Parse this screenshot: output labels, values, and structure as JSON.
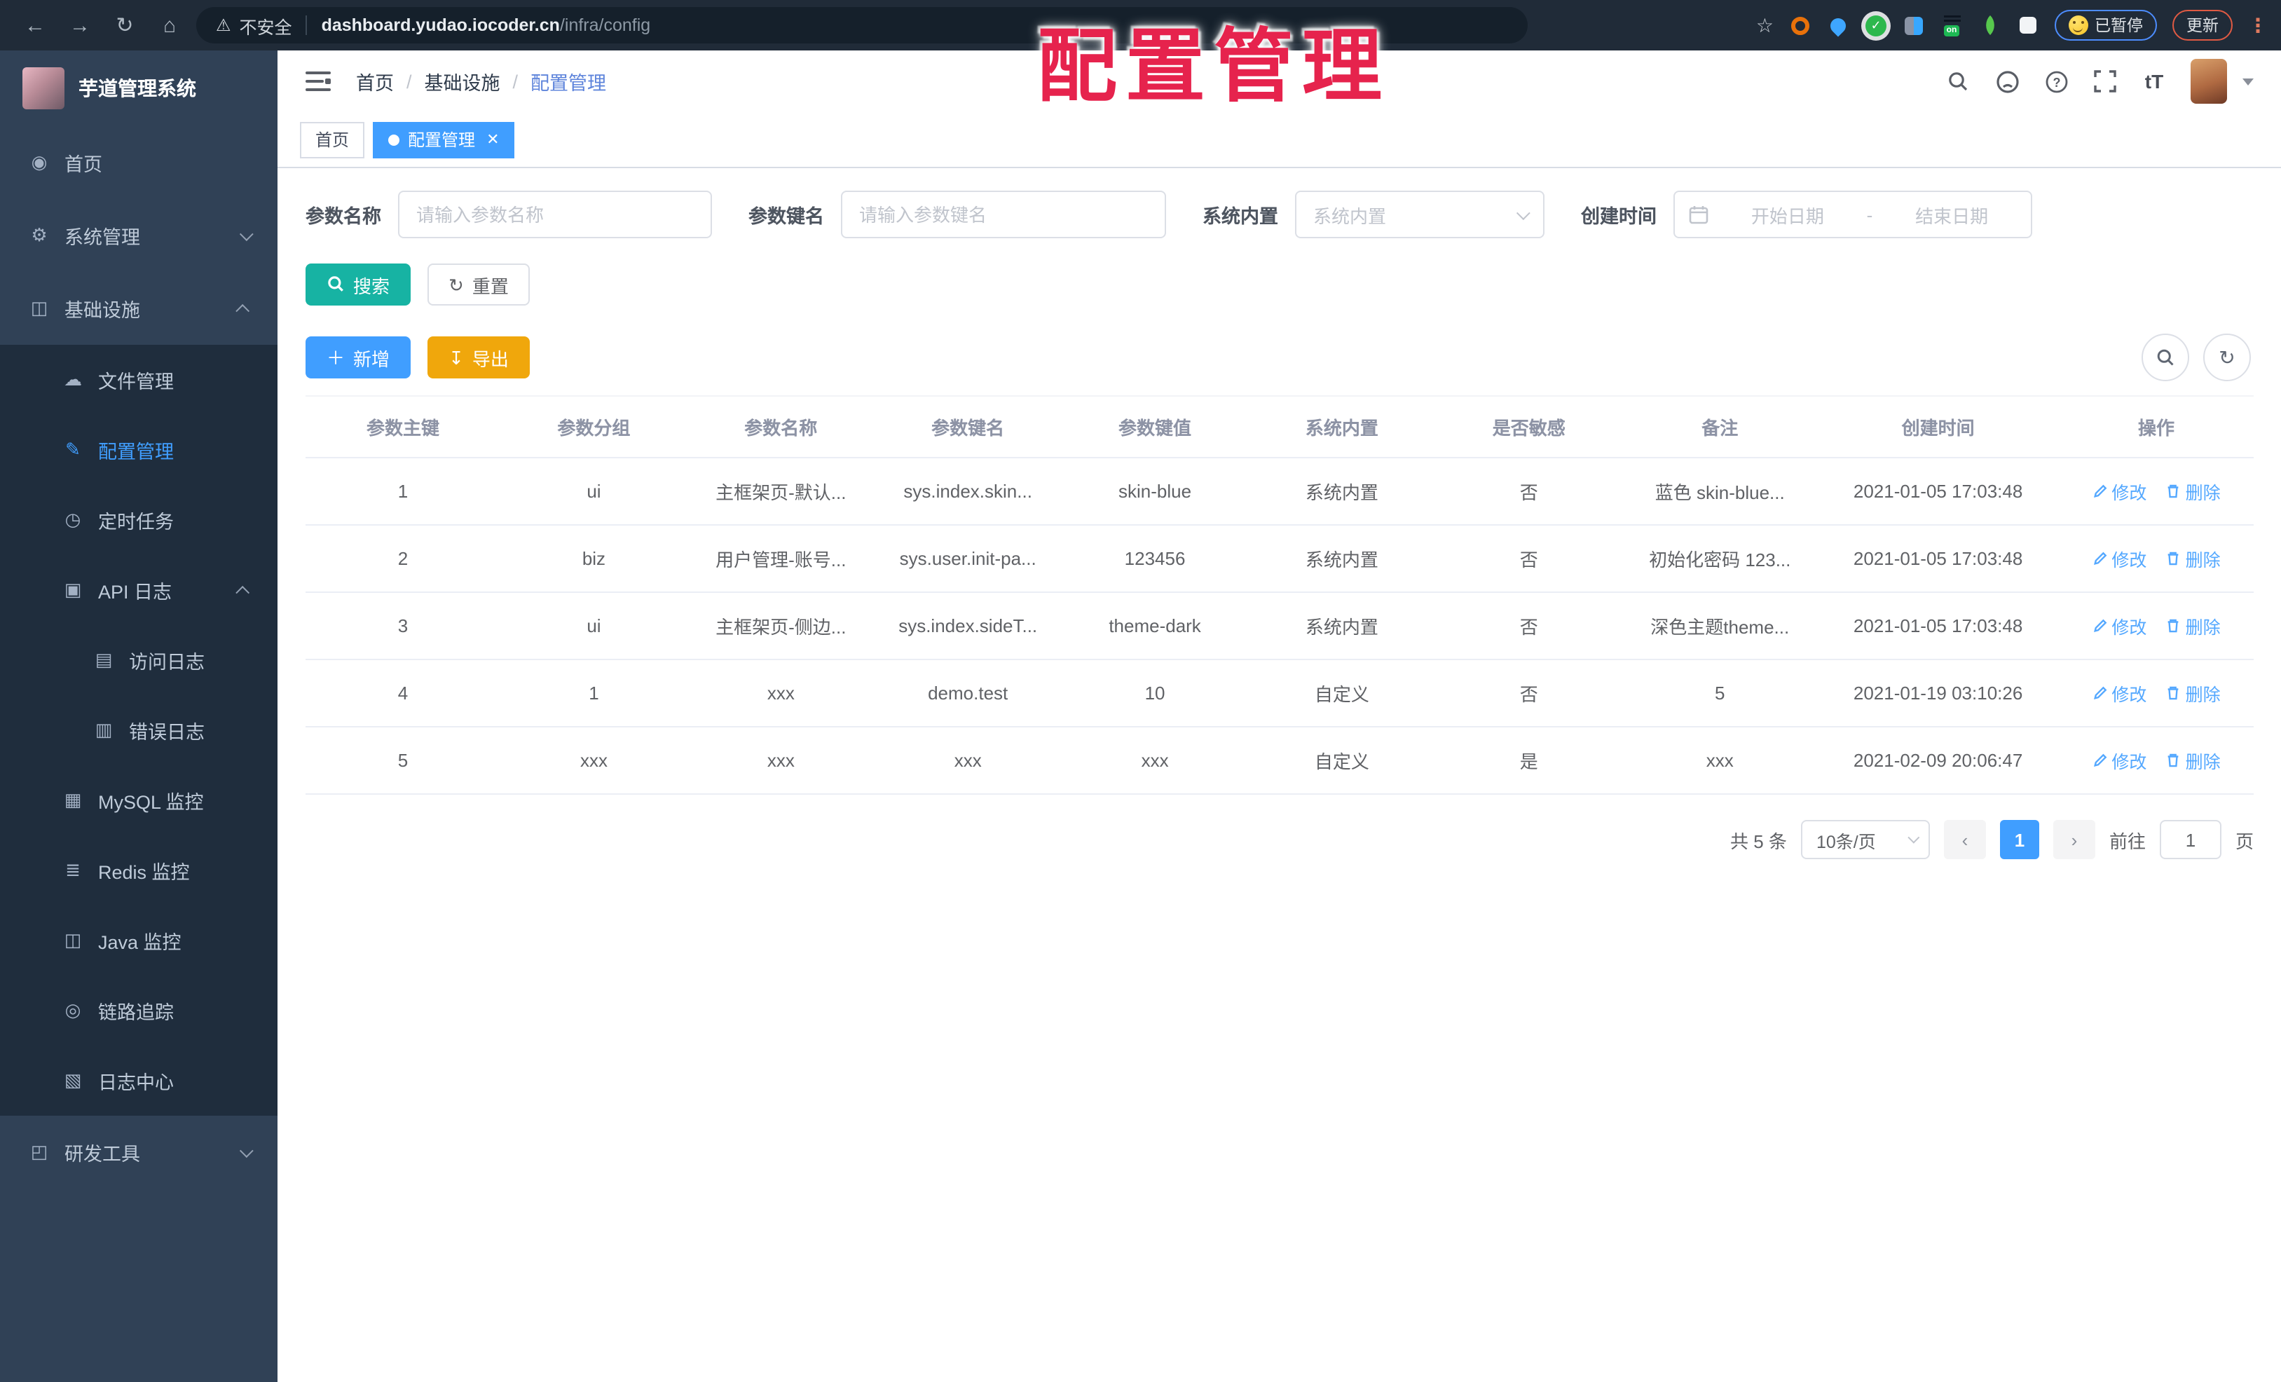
{
  "colors": {
    "accent": "#409EFF",
    "teal": "#17B3A3",
    "warn": "#F0A70C",
    "overlay": "#E6234D",
    "sidebar": "#304156",
    "submenu": "#1F2D3D",
    "sidebartext": "#BFCBD9",
    "browserbar": "#202B38",
    "linkblue": "#54A8FF"
  },
  "overlay_title": "配置管理",
  "browser": {
    "security_label": "不安全",
    "url_host": "dashboard.yudao.iocoder.cn",
    "url_path": "/infra/config",
    "ext_on_label": "on",
    "paused_badge": "已暂停",
    "update_button": "更新"
  },
  "sidebar": {
    "app_title": "芋道管理系统",
    "items": [
      {
        "label": "首页",
        "icon": "dashboard-icon"
      },
      {
        "label": "系统管理",
        "icon": "gear-icon"
      },
      {
        "label": "基础设施",
        "icon": "monitor-icon"
      },
      {
        "label": "文件管理",
        "icon": "cloud-icon"
      },
      {
        "label": "配置管理",
        "icon": "edit-icon"
      },
      {
        "label": "定时任务",
        "icon": "clock-icon"
      },
      {
        "label": "API 日志",
        "icon": "api-log-icon"
      },
      {
        "label": "访问日志",
        "icon": "access-log-icon"
      },
      {
        "label": "错误日志",
        "icon": "error-log-icon"
      },
      {
        "label": "MySQL 监控",
        "icon": "mysql-icon"
      },
      {
        "label": "Redis 监控",
        "icon": "redis-icon"
      },
      {
        "label": "Java 监控",
        "icon": "java-icon"
      },
      {
        "label": "链路追踪",
        "icon": "trace-eye-icon"
      },
      {
        "label": "日志中心",
        "icon": "log-center-icon"
      },
      {
        "label": "研发工具",
        "icon": "briefcase-icon"
      }
    ]
  },
  "header": {
    "breadcrumb": [
      "首页",
      "基础设施",
      "配置管理"
    ]
  },
  "tabs": [
    {
      "label": "首页"
    },
    {
      "label": "配置管理"
    }
  ],
  "filters": {
    "name_label": "参数名称",
    "name_placeholder": "请输入参数名称",
    "key_label": "参数键名",
    "key_placeholder": "请输入参数键名",
    "type_label": "系统内置",
    "type_placeholder": "系统内置",
    "date_label": "创建时间",
    "date_start": "开始日期",
    "date_sep": "-",
    "date_end": "结束日期"
  },
  "actions": {
    "search": "搜索",
    "reset": "重置",
    "create": "新增",
    "export": "导出"
  },
  "table": {
    "columns": [
      "参数主键",
      "参数分组",
      "参数名称",
      "参数键名",
      "参数键值",
      "系统内置",
      "是否敏感",
      "备注",
      "创建时间",
      "操作"
    ],
    "edit_label": "修改",
    "delete_label": "删除",
    "rows": [
      {
        "id": "1",
        "group": "ui",
        "name": "主框架页-默认...",
        "key": "sys.index.skin...",
        "value": "skin-blue",
        "type": "系统内置",
        "sensitive": "否",
        "remark": "蓝色 skin-blue...",
        "created": "2021-01-05 17:03:48"
      },
      {
        "id": "2",
        "group": "biz",
        "name": "用户管理-账号...",
        "key": "sys.user.init-pa...",
        "value": "123456",
        "type": "系统内置",
        "sensitive": "否",
        "remark": "初始化密码 123...",
        "created": "2021-01-05 17:03:48"
      },
      {
        "id": "3",
        "group": "ui",
        "name": "主框架页-侧边...",
        "key": "sys.index.sideT...",
        "value": "theme-dark",
        "type": "系统内置",
        "sensitive": "否",
        "remark": "深色主题theme...",
        "created": "2021-01-05 17:03:48"
      },
      {
        "id": "4",
        "group": "1",
        "name": "xxx",
        "key": "demo.test",
        "value": "10",
        "type": "自定义",
        "sensitive": "否",
        "remark": "5",
        "created": "2021-01-19 03:10:26"
      },
      {
        "id": "5",
        "group": "xxx",
        "name": "xxx",
        "key": "xxx",
        "value": "xxx",
        "type": "自定义",
        "sensitive": "是",
        "remark": "xxx",
        "created": "2021-02-09 20:06:47"
      }
    ]
  },
  "pagination": {
    "total": "共 5 条",
    "page_size": "10条/页",
    "current_page": "1",
    "goto_label": "前往",
    "goto_value": "1",
    "page_unit": "页"
  }
}
